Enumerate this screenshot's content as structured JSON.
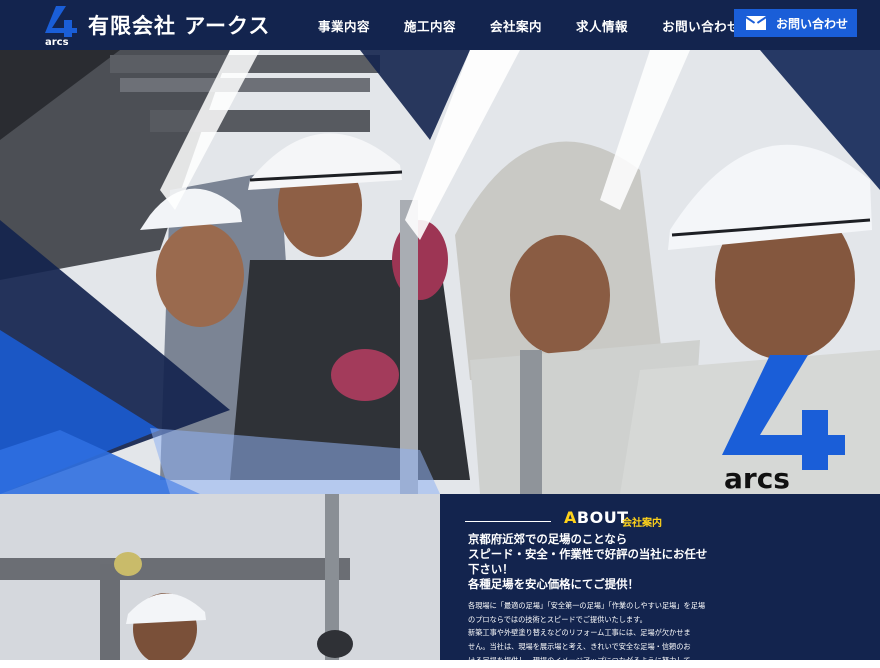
{
  "header": {
    "company_name": "有限会社 アークス",
    "logo_word": "arcs",
    "nav": [
      "事業内容",
      "施工内容",
      "会社案内",
      "求人情報",
      "お問い合わせ"
    ],
    "contact_button": "お問い合わせ"
  },
  "hero": {
    "brand_word": "arcs",
    "helmet_text": "arcs"
  },
  "about": {
    "title_first": "A",
    "title_rest": "BOUT",
    "subtitle": "会社案内",
    "lead_lines": [
      "京都府近郊での足場のことなら",
      "スピード・安全・作業性で好評の当社にお任せ",
      "下さい！",
      "各種足場を安心価格にてご提供！"
    ],
    "body_lines": [
      "各現場に「最適の足場」「安全第一の足場」「作業のしやすい足場」を足場",
      "のプロならではの技術とスピードでご提供いたします。",
      "新築工事や外壁塗り替えなどのリフォーム工事には、足場が欠かせま",
      "せん。当社は、現場を展示場と考え、きれいで安全な足場・信頼のお",
      "ける足場を提供し、現場のイメージアップにつながるように努力して"
    ]
  },
  "colors": {
    "navy": "#13244e",
    "accent_blue": "#1a5ed8",
    "highlight_yellow": "#ffd21a"
  }
}
